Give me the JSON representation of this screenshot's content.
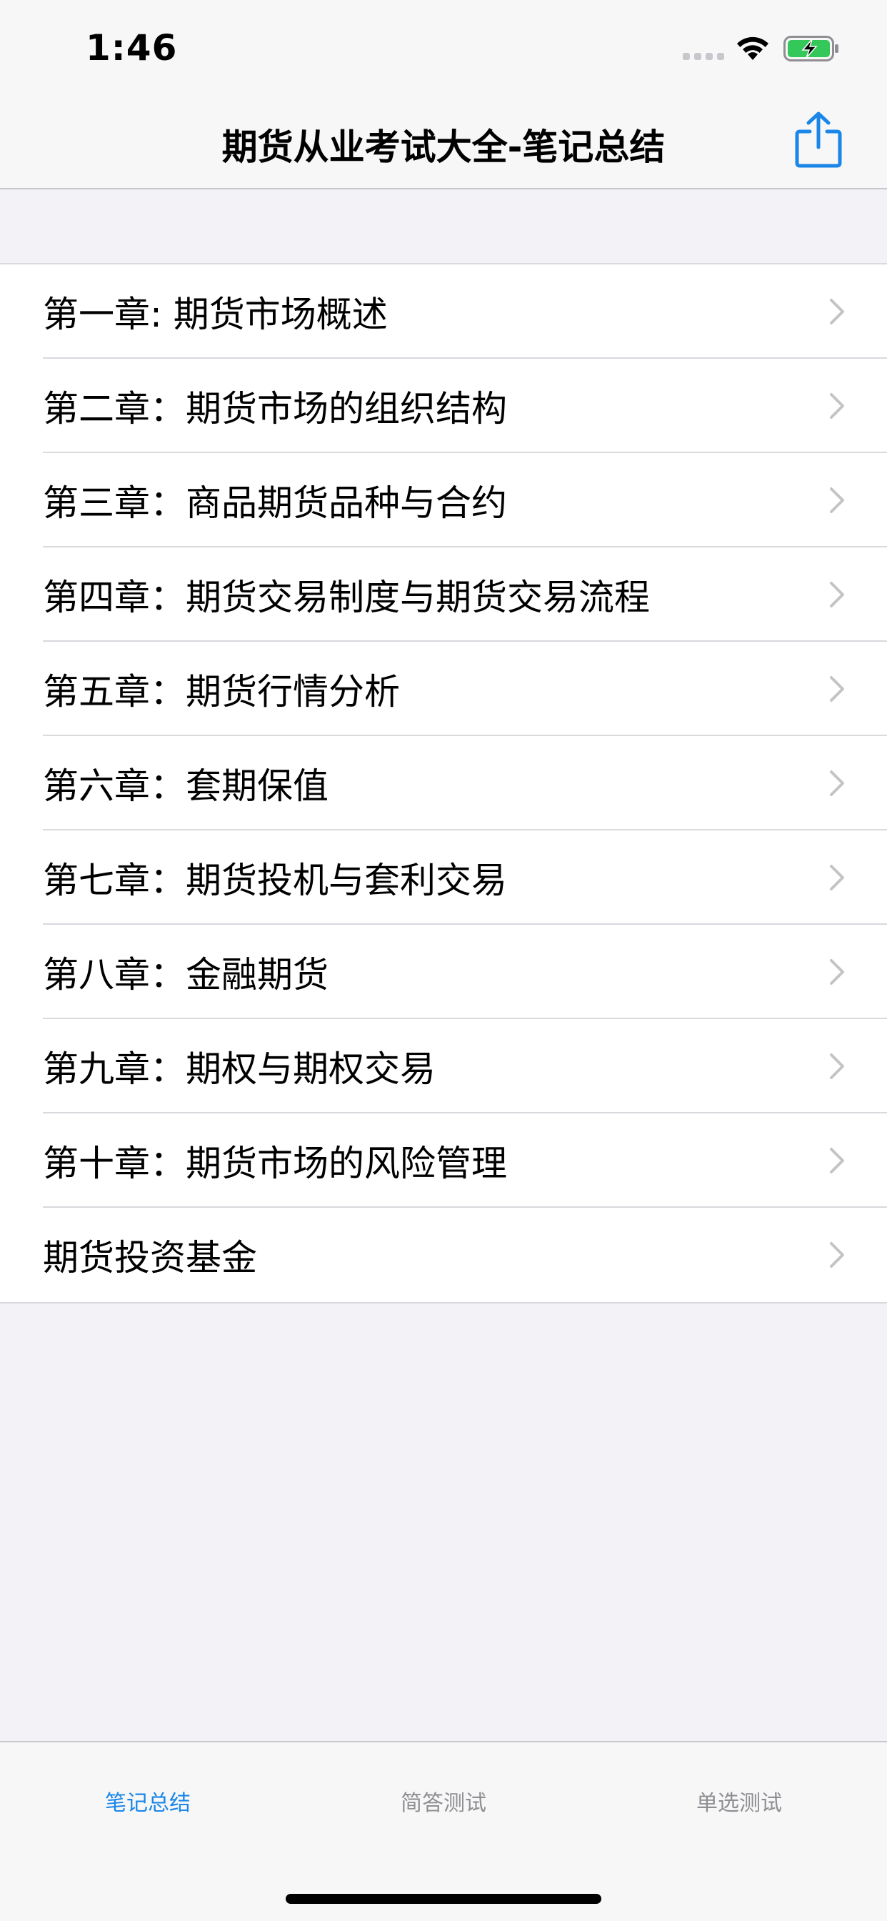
{
  "status": {
    "time": "1:46"
  },
  "nav": {
    "title": "期货从业考试大全-笔记总结",
    "share_icon": "share-icon"
  },
  "list": {
    "items": [
      {
        "label": "第一章: 期货市场概述"
      },
      {
        "label": "第二章：期货市场的组织结构"
      },
      {
        "label": "第三章：商品期货品种与合约"
      },
      {
        "label": "第四章：期货交易制度与期货交易流程"
      },
      {
        "label": "第五章：期货行情分析"
      },
      {
        "label": "第六章：套期保值"
      },
      {
        "label": "第七章：期货投机与套利交易"
      },
      {
        "label": "第八章：金融期货"
      },
      {
        "label": "第九章：期权与期权交易"
      },
      {
        "label": "第十章：期货市场的风险管理"
      },
      {
        "label": "期货投资基金"
      }
    ]
  },
  "tabs": [
    {
      "label": "笔记总结",
      "active": true
    },
    {
      "label": "简答测试",
      "active": false
    },
    {
      "label": "单选测试",
      "active": false
    }
  ],
  "colors": {
    "accent": "#1a86e8",
    "battery_green": "#34c759",
    "inactive": "#8e8e93"
  }
}
